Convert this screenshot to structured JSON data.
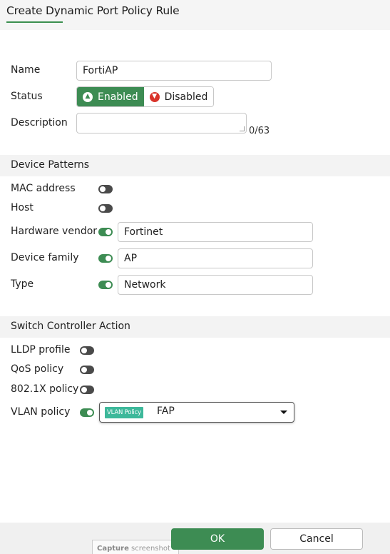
{
  "header": {
    "title": "Create Dynamic Port Policy Rule"
  },
  "form": {
    "name_label": "Name",
    "name_value": "FortiAP",
    "status_label": "Status",
    "status_enabled": "Enabled",
    "status_disabled": "Disabled",
    "status_selected": "Enabled",
    "description_label": "Description",
    "description_value": "",
    "description_counter": "0/63"
  },
  "device_patterns": {
    "title": "Device Patterns",
    "mac_label": "MAC address",
    "mac_enabled": false,
    "host_label": "Host",
    "host_enabled": false,
    "hw_vendor_label": "Hardware vendor",
    "hw_vendor_enabled": true,
    "hw_vendor_value": "Fortinet",
    "family_label": "Device family",
    "family_enabled": true,
    "family_value": "AP",
    "type_label": "Type",
    "type_enabled": true,
    "type_value": "Network"
  },
  "action": {
    "title": "Switch Controller Action",
    "lldp_label": "LLDP profile",
    "lldp_enabled": false,
    "qos_label": "QoS policy",
    "qos_enabled": false,
    "dot1x_label": "802.1X policy",
    "dot1x_enabled": false,
    "vlan_label": "VLAN policy",
    "vlan_enabled": true,
    "vlan_badge": "VLAN Policy",
    "vlan_value": "FAP"
  },
  "footer": {
    "ok": "OK",
    "cancel": "Cancel"
  },
  "overlay": {
    "capture_bold": "Capture",
    "capture_rest": " screenshot"
  },
  "colors": {
    "accent": "#3d8c53",
    "danger": "#d9342b",
    "badge": "#3db89a"
  },
  "icons": {
    "enabled": "arrow-up-circle-icon",
    "disabled": "arrow-down-circle-icon",
    "dropdown": "caret-down-icon"
  }
}
